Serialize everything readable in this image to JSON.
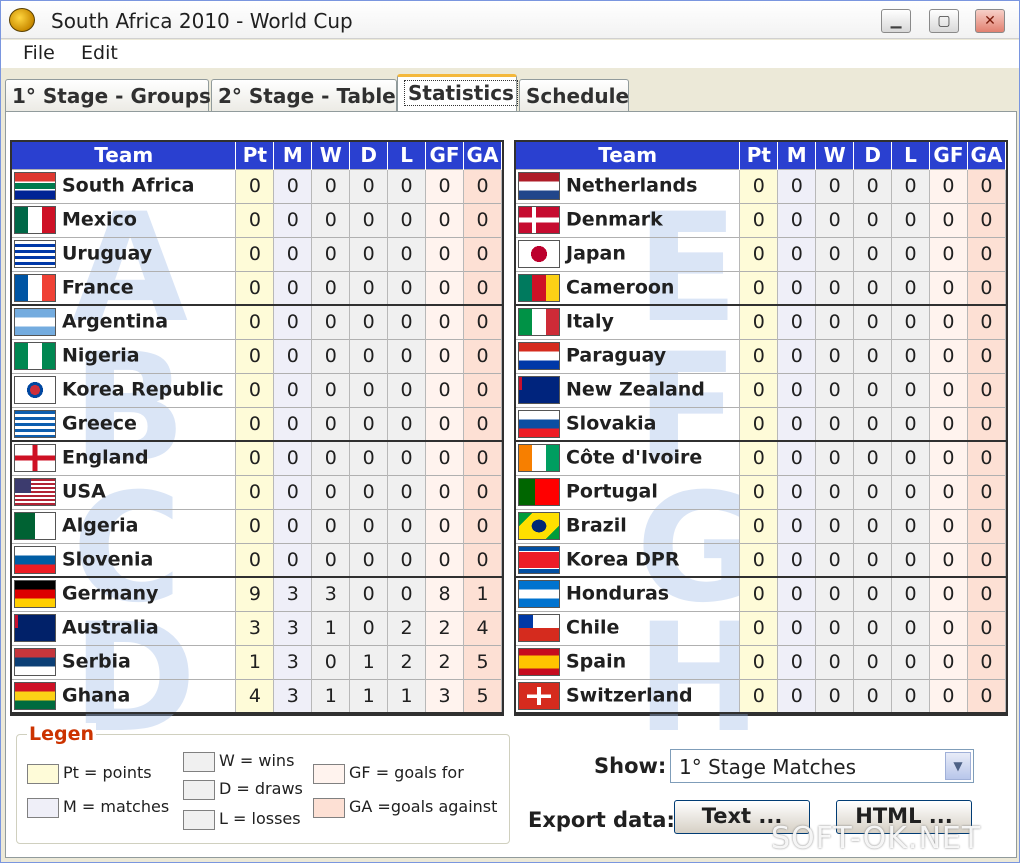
{
  "window": {
    "title": "South Africa 2010 - World Cup",
    "controls": {
      "minimize": "▁",
      "maximize": "▢",
      "close": "✕"
    }
  },
  "menu": [
    "File",
    "Edit"
  ],
  "tabs": [
    "1° Stage - Groups",
    "2° Stage - Table",
    "Statistics",
    "Schedule"
  ],
  "active_tab": "Statistics",
  "columns": [
    "Team",
    "Pt",
    "M",
    "W",
    "D",
    "L",
    "GF",
    "GA"
  ],
  "group_watermarks": {
    "left": [
      "A",
      "B",
      "C",
      "D"
    ],
    "right": [
      "E",
      "F",
      "G",
      "H"
    ]
  },
  "left_table": [
    {
      "team": "South Africa",
      "flag": "south-africa",
      "pt": "0",
      "m": "0",
      "w": "0",
      "d": "0",
      "l": "0",
      "gf": "0",
      "ga": "0"
    },
    {
      "team": "Mexico",
      "flag": "mexico",
      "pt": "0",
      "m": "0",
      "w": "0",
      "d": "0",
      "l": "0",
      "gf": "0",
      "ga": "0"
    },
    {
      "team": "Uruguay",
      "flag": "uruguay",
      "pt": "0",
      "m": "0",
      "w": "0",
      "d": "0",
      "l": "0",
      "gf": "0",
      "ga": "0"
    },
    {
      "team": "France",
      "flag": "france",
      "pt": "0",
      "m": "0",
      "w": "0",
      "d": "0",
      "l": "0",
      "gf": "0",
      "ga": "0"
    },
    {
      "team": "Argentina",
      "flag": "argentina",
      "pt": "0",
      "m": "0",
      "w": "0",
      "d": "0",
      "l": "0",
      "gf": "0",
      "ga": "0"
    },
    {
      "team": "Nigeria",
      "flag": "nigeria",
      "pt": "0",
      "m": "0",
      "w": "0",
      "d": "0",
      "l": "0",
      "gf": "0",
      "ga": "0"
    },
    {
      "team": "Korea Republic",
      "flag": "korea-republic",
      "pt": "0",
      "m": "0",
      "w": "0",
      "d": "0",
      "l": "0",
      "gf": "0",
      "ga": "0"
    },
    {
      "team": "Greece",
      "flag": "greece",
      "pt": "0",
      "m": "0",
      "w": "0",
      "d": "0",
      "l": "0",
      "gf": "0",
      "ga": "0"
    },
    {
      "team": "England",
      "flag": "england",
      "pt": "0",
      "m": "0",
      "w": "0",
      "d": "0",
      "l": "0",
      "gf": "0",
      "ga": "0"
    },
    {
      "team": "USA",
      "flag": "usa",
      "pt": "0",
      "m": "0",
      "w": "0",
      "d": "0",
      "l": "0",
      "gf": "0",
      "ga": "0"
    },
    {
      "team": "Algeria",
      "flag": "algeria",
      "pt": "0",
      "m": "0",
      "w": "0",
      "d": "0",
      "l": "0",
      "gf": "0",
      "ga": "0"
    },
    {
      "team": "Slovenia",
      "flag": "slovenia",
      "pt": "0",
      "m": "0",
      "w": "0",
      "d": "0",
      "l": "0",
      "gf": "0",
      "ga": "0"
    },
    {
      "team": "Germany",
      "flag": "germany",
      "pt": "9",
      "m": "3",
      "w": "3",
      "d": "0",
      "l": "0",
      "gf": "8",
      "ga": "1"
    },
    {
      "team": "Australia",
      "flag": "australia",
      "pt": "3",
      "m": "3",
      "w": "1",
      "d": "0",
      "l": "2",
      "gf": "2",
      "ga": "4"
    },
    {
      "team": "Serbia",
      "flag": "serbia",
      "pt": "1",
      "m": "3",
      "w": "0",
      "d": "1",
      "l": "2",
      "gf": "2",
      "ga": "5"
    },
    {
      "team": "Ghana",
      "flag": "ghana",
      "pt": "4",
      "m": "3",
      "w": "1",
      "d": "1",
      "l": "1",
      "gf": "3",
      "ga": "5"
    }
  ],
  "right_table": [
    {
      "team": "Netherlands",
      "flag": "netherlands",
      "pt": "0",
      "m": "0",
      "w": "0",
      "d": "0",
      "l": "0",
      "gf": "0",
      "ga": "0"
    },
    {
      "team": "Denmark",
      "flag": "denmark",
      "pt": "0",
      "m": "0",
      "w": "0",
      "d": "0",
      "l": "0",
      "gf": "0",
      "ga": "0"
    },
    {
      "team": "Japan",
      "flag": "japan",
      "pt": "0",
      "m": "0",
      "w": "0",
      "d": "0",
      "l": "0",
      "gf": "0",
      "ga": "0"
    },
    {
      "team": "Cameroon",
      "flag": "cameroon",
      "pt": "0",
      "m": "0",
      "w": "0",
      "d": "0",
      "l": "0",
      "gf": "0",
      "ga": "0"
    },
    {
      "team": "Italy",
      "flag": "italy",
      "pt": "0",
      "m": "0",
      "w": "0",
      "d": "0",
      "l": "0",
      "gf": "0",
      "ga": "0"
    },
    {
      "team": "Paraguay",
      "flag": "paraguay",
      "pt": "0",
      "m": "0",
      "w": "0",
      "d": "0",
      "l": "0",
      "gf": "0",
      "ga": "0"
    },
    {
      "team": "New Zealand",
      "flag": "new-zealand",
      "pt": "0",
      "m": "0",
      "w": "0",
      "d": "0",
      "l": "0",
      "gf": "0",
      "ga": "0"
    },
    {
      "team": "Slovakia",
      "flag": "slovakia",
      "pt": "0",
      "m": "0",
      "w": "0",
      "d": "0",
      "l": "0",
      "gf": "0",
      "ga": "0"
    },
    {
      "team": "Côte d'Ivoire",
      "flag": "cote-divoire",
      "pt": "0",
      "m": "0",
      "w": "0",
      "d": "0",
      "l": "0",
      "gf": "0",
      "ga": "0"
    },
    {
      "team": "Portugal",
      "flag": "portugal",
      "pt": "0",
      "m": "0",
      "w": "0",
      "d": "0",
      "l": "0",
      "gf": "0",
      "ga": "0"
    },
    {
      "team": "Brazil",
      "flag": "brazil",
      "pt": "0",
      "m": "0",
      "w": "0",
      "d": "0",
      "l": "0",
      "gf": "0",
      "ga": "0"
    },
    {
      "team": "Korea DPR",
      "flag": "korea-dpr",
      "pt": "0",
      "m": "0",
      "w": "0",
      "d": "0",
      "l": "0",
      "gf": "0",
      "ga": "0"
    },
    {
      "team": "Honduras",
      "flag": "honduras",
      "pt": "0",
      "m": "0",
      "w": "0",
      "d": "0",
      "l": "0",
      "gf": "0",
      "ga": "0"
    },
    {
      "team": "Chile",
      "flag": "chile",
      "pt": "0",
      "m": "0",
      "w": "0",
      "d": "0",
      "l": "0",
      "gf": "0",
      "ga": "0"
    },
    {
      "team": "Spain",
      "flag": "spain",
      "pt": "0",
      "m": "0",
      "w": "0",
      "d": "0",
      "l": "0",
      "gf": "0",
      "ga": "0"
    },
    {
      "team": "Switzerland",
      "flag": "switzerland",
      "pt": "0",
      "m": "0",
      "w": "0",
      "d": "0",
      "l": "0",
      "gf": "0",
      "ga": "0"
    }
  ],
  "legend": {
    "title": "Legen",
    "items": [
      {
        "key": "pt",
        "label": "Pt = points",
        "color": "#fefbd8"
      },
      {
        "key": "m",
        "label": "M = matches",
        "color": "#efeff8"
      },
      {
        "key": "w",
        "label": "W = wins",
        "color": "#f0f0f0"
      },
      {
        "key": "d",
        "label": "D = draws",
        "color": "#f0f0f0"
      },
      {
        "key": "l",
        "label": "L = losses",
        "color": "#f0f0f0"
      },
      {
        "key": "gf",
        "label": "GF = goals for",
        "color": "#fff3ee"
      },
      {
        "key": "ga",
        "label": "GA =goals against",
        "color": "#fde0d4"
      }
    ]
  },
  "show": {
    "label": "Show:",
    "value": "1° Stage Matches"
  },
  "export": {
    "label": "Export data:",
    "text_button": "Text ...",
    "html_button": "HTML ..."
  },
  "watermark": "SOFT-OK.NET",
  "colors": {
    "header_blue": "#2a40d0",
    "tab_accent": "#f4b83c",
    "legend_title": "#cc3300"
  }
}
